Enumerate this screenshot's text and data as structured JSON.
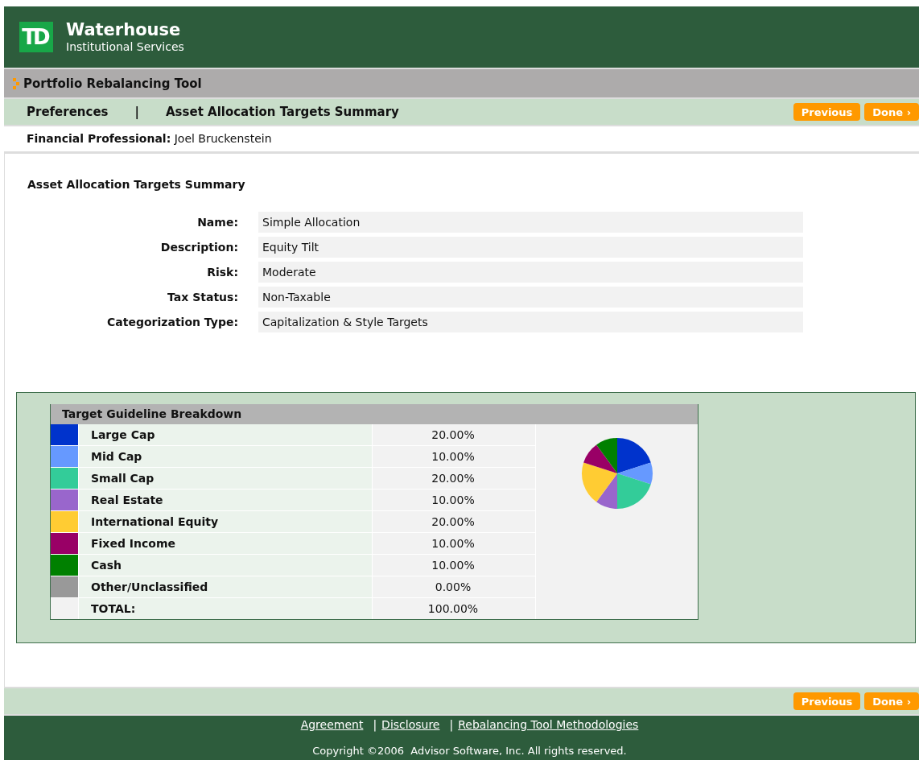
{
  "header": {
    "logo_text": "TD",
    "brand": "Waterhouse",
    "subtitle": "Institutional Services"
  },
  "tool_bar": {
    "title": "Portfolio Rebalancing Tool"
  },
  "nav": {
    "links": [
      "Preferences",
      "Asset Allocation Targets Summary"
    ],
    "separator": "|",
    "buttons": [
      "Previous",
      "Done ›"
    ]
  },
  "professional": {
    "label": "Financial Professional:",
    "value": "Joel Bruckenstein"
  },
  "summary": {
    "title": "Asset Allocation Targets Summary",
    "fields": [
      {
        "label": "Name:",
        "value": "Simple Allocation"
      },
      {
        "label": "Description:",
        "value": "Equity Tilt"
      },
      {
        "label": "Risk:",
        "value": "Moderate"
      },
      {
        "label": "Tax Status:",
        "value": "Non-Taxable"
      },
      {
        "label": "Categorization Type:",
        "value": "Capitalization & Style Targets"
      }
    ]
  },
  "breakdown": {
    "title": "Target Guideline Breakdown",
    "rows": [
      {
        "label": "Large Cap",
        "value": "20.00%",
        "color": "#0033cc"
      },
      {
        "label": "Mid Cap",
        "value": "10.00%",
        "color": "#6699ff"
      },
      {
        "label": "Small Cap",
        "value": "20.00%",
        "color": "#33cc99"
      },
      {
        "label": "Real Estate",
        "value": "10.00%",
        "color": "#9966cc"
      },
      {
        "label": "International Equity",
        "value": "20.00%",
        "color": "#ffcc33"
      },
      {
        "label": "Fixed Income",
        "value": "10.00%",
        "color": "#990066"
      },
      {
        "label": "Cash",
        "value": "10.00%",
        "color": "#008000"
      },
      {
        "label": "Other/Unclassified",
        "value": "0.00%",
        "color": "#999999"
      }
    ],
    "total": {
      "label": "TOTAL:",
      "value": "100.00%"
    },
    "chart_data": {
      "type": "pie",
      "values": [
        20,
        10,
        20,
        10,
        20,
        10,
        10,
        0
      ]
    }
  },
  "bottom_nav": {
    "buttons": [
      "Previous",
      "Done ›"
    ]
  },
  "footer": {
    "links": [
      "Agreement",
      "Disclosure",
      "Rebalancing Tool Methodologies"
    ],
    "separator": "|",
    "copyright": "Copyright ©2006  Advisor Software, Inc. All rights reserved."
  }
}
